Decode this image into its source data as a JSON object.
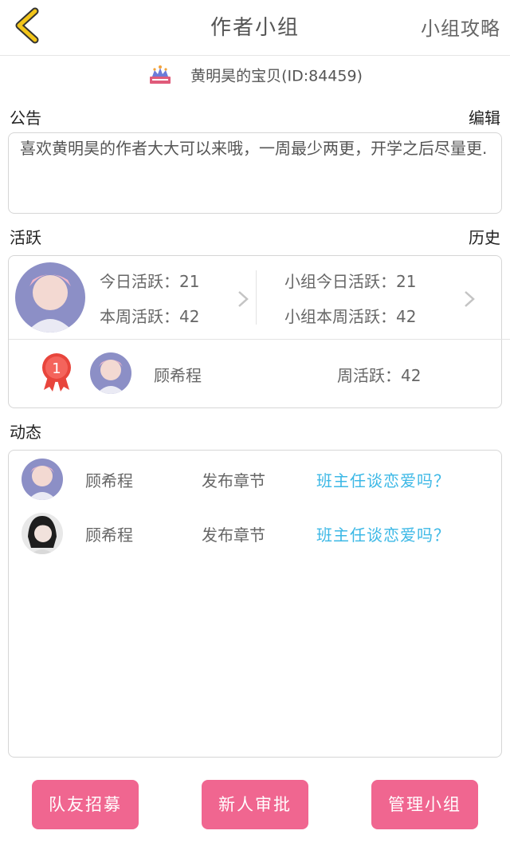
{
  "header": {
    "title": "作者小组",
    "right_link": "小组攻略"
  },
  "owner": {
    "name": "黄明昊的宝贝(ID:84459)"
  },
  "notice": {
    "label": "公告",
    "edit": "编辑",
    "text": "喜欢黄明昊的作者大大可以来哦，一周最少两更，开学之后尽量更."
  },
  "activity": {
    "label": "活跃",
    "history": "历史",
    "today": "今日活跃：21",
    "week": "本周活跃：42",
    "group_today": "小组今日活跃：21",
    "group_week": "小组本周活跃：42",
    "rank": {
      "badge": "1",
      "name": "顾希程",
      "weekly": "周活跃：42"
    }
  },
  "feed": {
    "label": "动态",
    "items": [
      {
        "name": "顾希程",
        "action": "发布章节",
        "title": "班主任谈恋爱吗？"
      },
      {
        "name": "顾希程",
        "action": "发布章节",
        "title": "班主任谈恋爱吗？"
      }
    ]
  },
  "buttons": {
    "recruit": "队友招募",
    "approve": "新人审批",
    "manage": "管理小组"
  },
  "colors": {
    "accent_yellow": "#f2c51a",
    "button_pink": "#f06690",
    "link_blue": "#3cb8e6",
    "badge_red": "#e8453c"
  }
}
